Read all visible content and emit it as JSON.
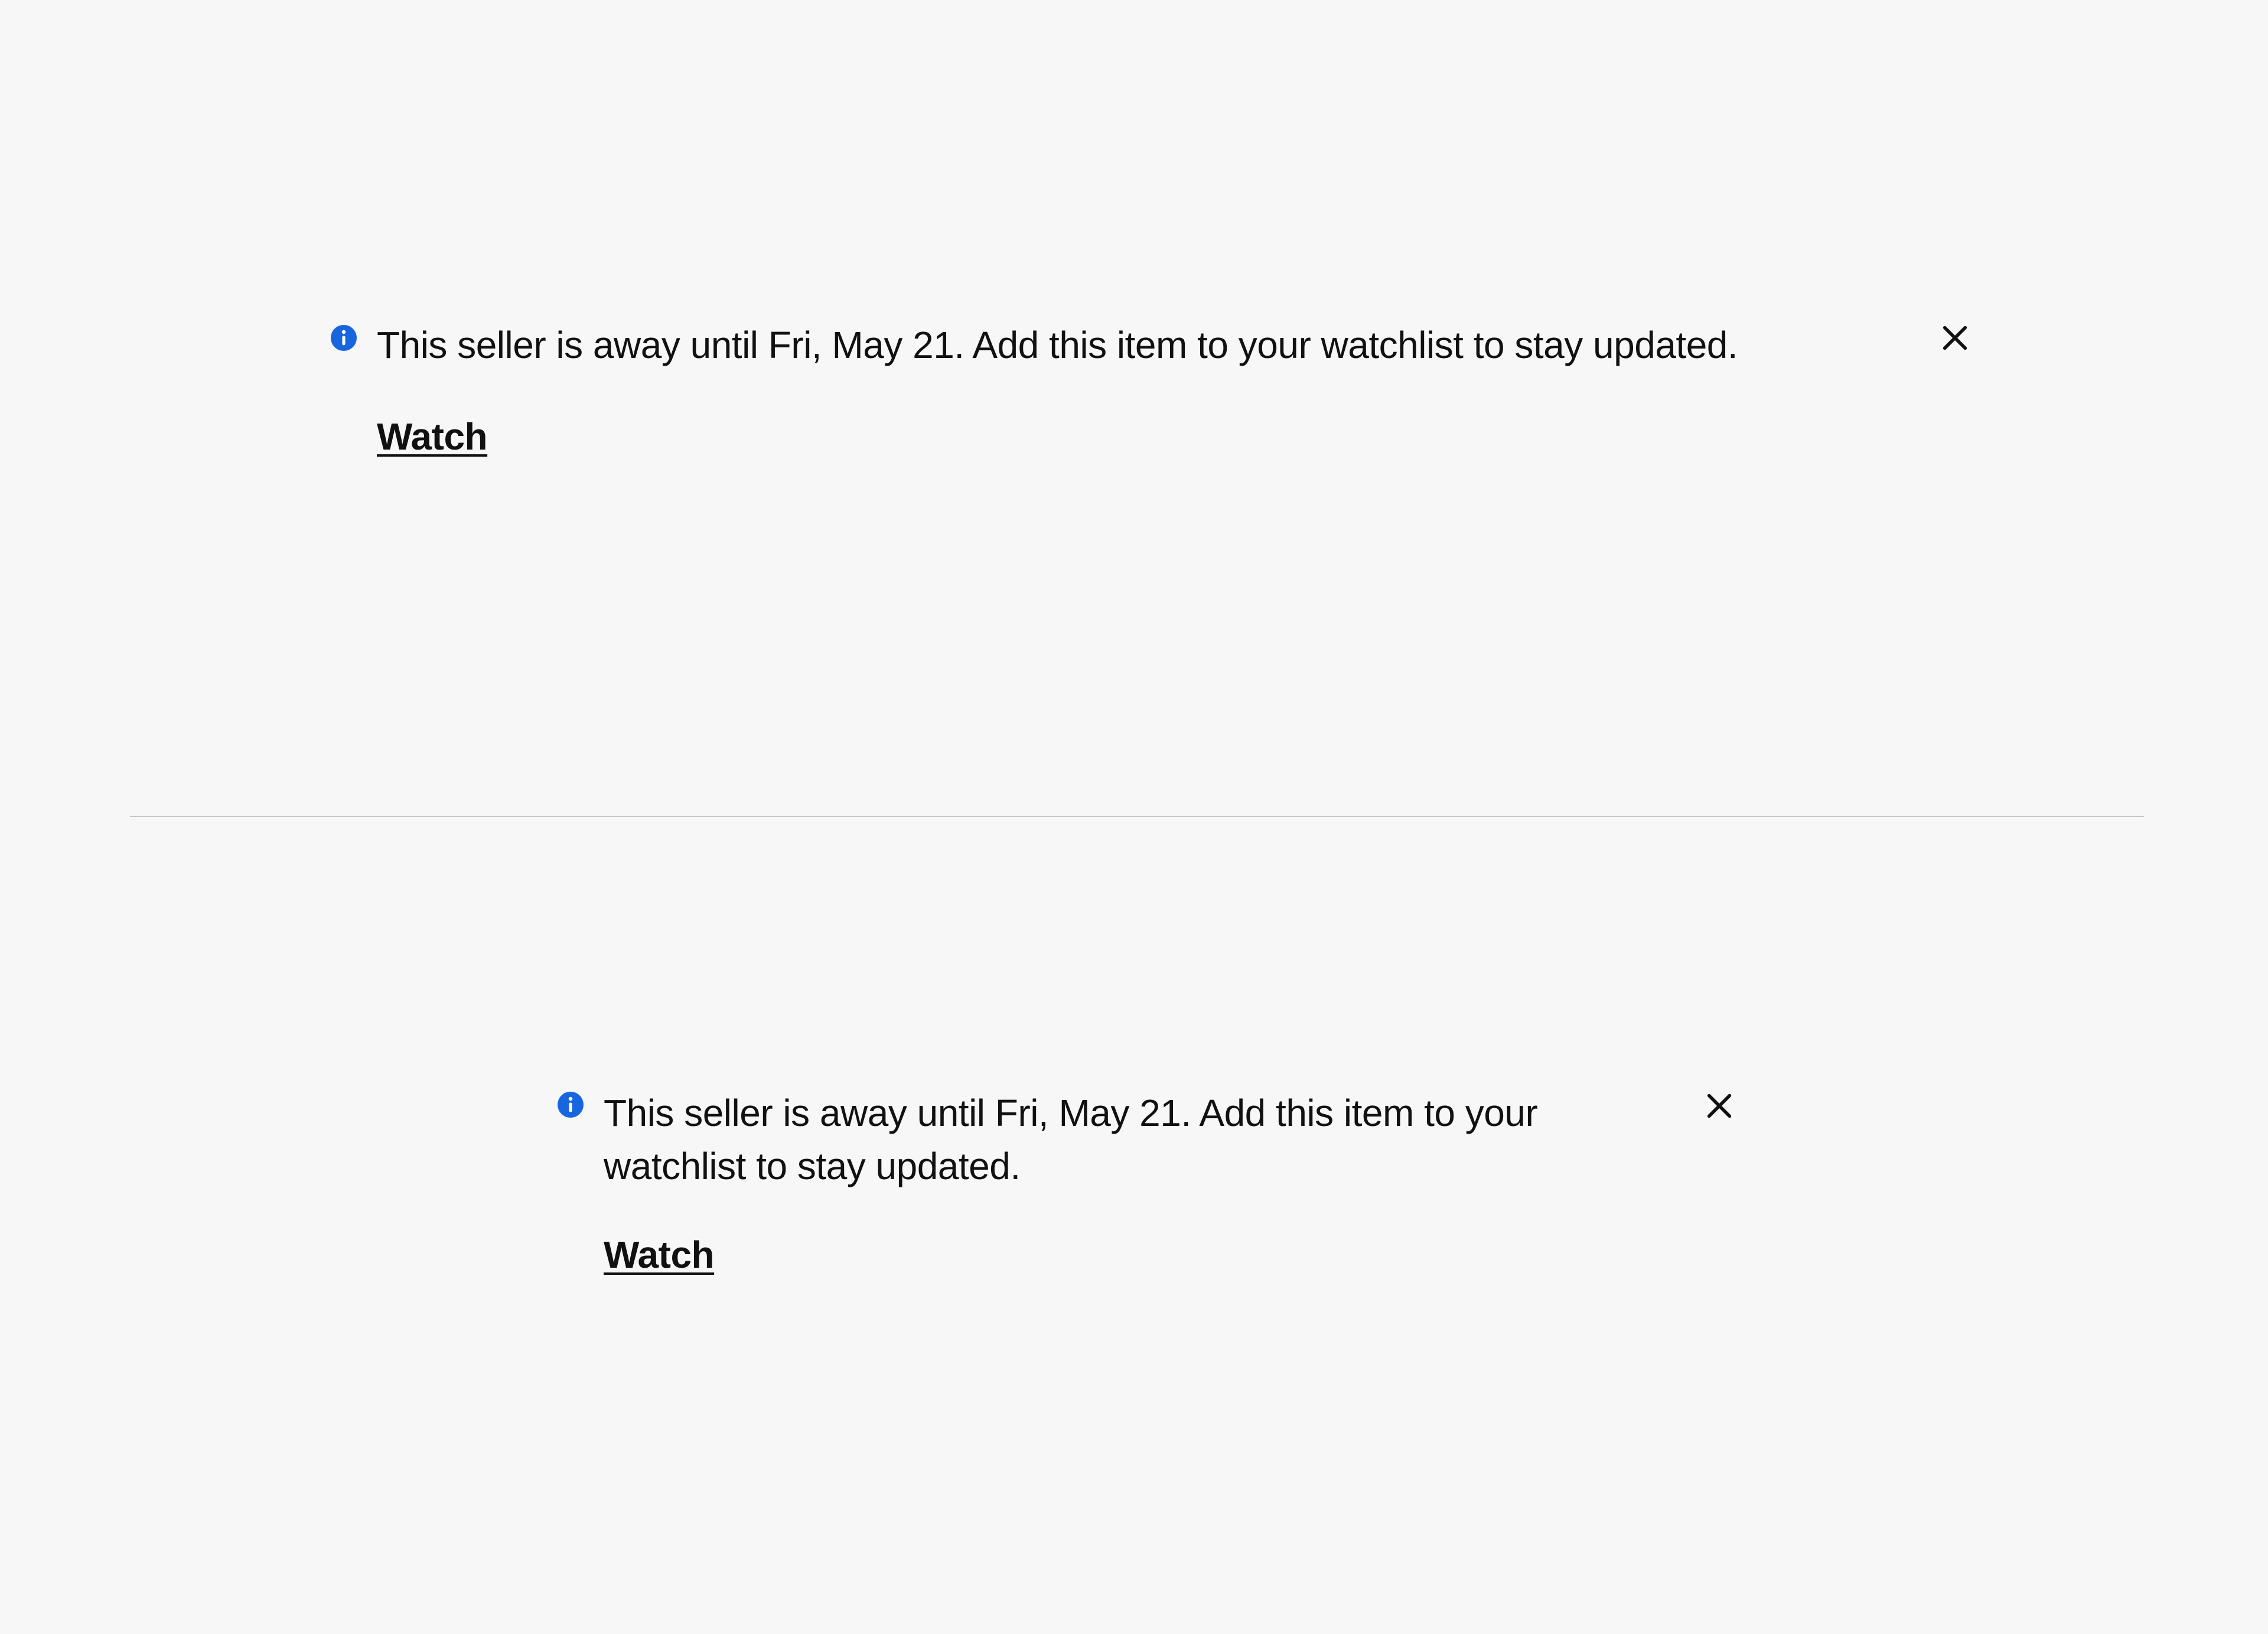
{
  "notices": [
    {
      "message": "This seller is away until Fri, May 21. Add this item to your watchlist to stay updated.",
      "action_label": "Watch"
    },
    {
      "message": "This seller is away until Fri, May 21. Add this item to your watchlist to stay updated.",
      "action_label": "Watch"
    }
  ],
  "colors": {
    "info_icon": "#1766e0",
    "text": "#111111",
    "background": "#f7f7f7"
  }
}
